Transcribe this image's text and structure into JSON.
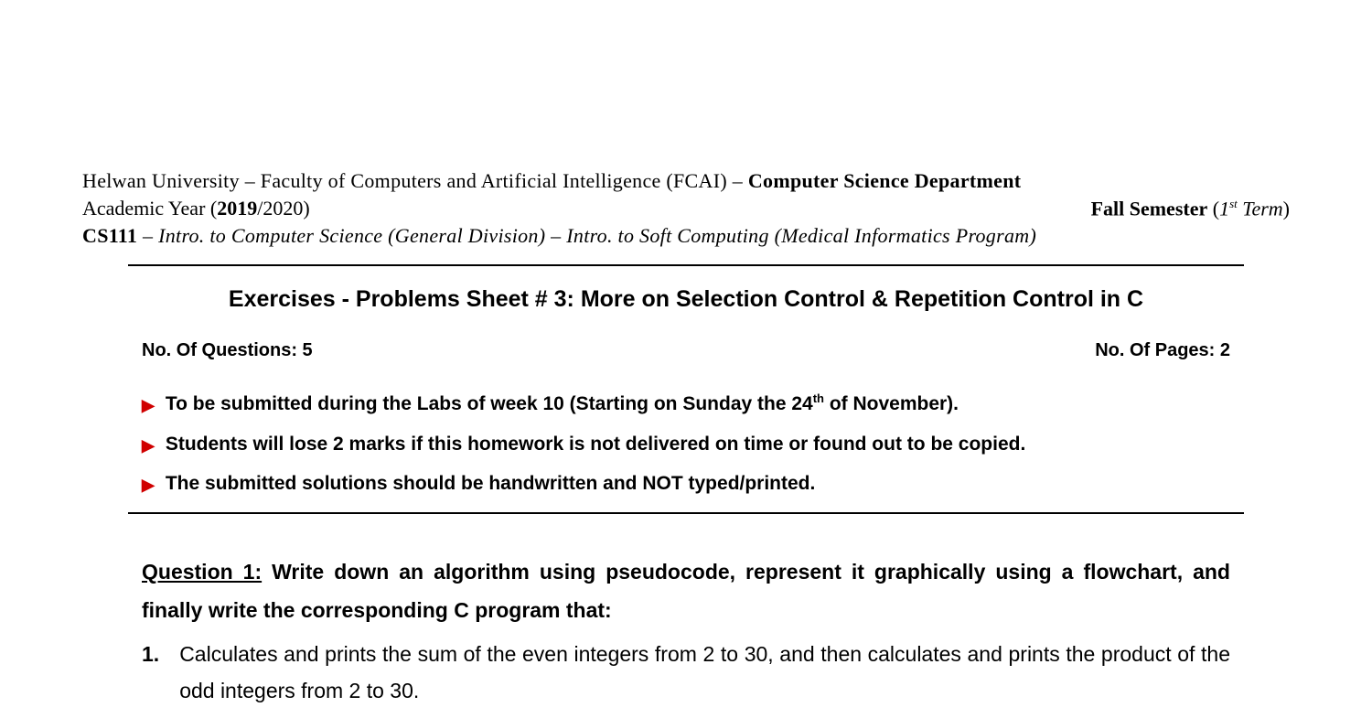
{
  "header": {
    "line1_prefix": "Helwan University – Faculty of Computers and Artificial Intelligence (FCAI) – ",
    "line1_bold": "Computer Science Department",
    "year_prefix": "Academic Year (",
    "year_bold": "2019",
    "year_suffix": "/2020)",
    "semester_bold": "Fall Semester",
    "semester_paren_open": " (",
    "semester_num": "1",
    "semester_sup": "st",
    "semester_italic": " Term",
    "semester_paren_close": ")",
    "course_bold": "CS111",
    "course_rest": " – Intro. to Computer Science (General Division) – Intro. to Soft Computing (Medical Informatics Program)"
  },
  "sheet": {
    "title": "Exercises - Problems Sheet # 3: More on Selection Control & Repetition Control in C",
    "num_questions": "No. Of Questions: 5",
    "num_pages": "No. Of Pages: 2"
  },
  "instructions": {
    "item1_a": "To be submitted during the Labs of week 10 (Starting on Sunday the 24",
    "item1_sup": "th",
    "item1_b": " of November).",
    "item2": "Students will lose 2 marks if this homework is not delivered on time or found out to be copied.",
    "item3": "The submitted solutions should be handwritten and NOT typed/printed."
  },
  "question1": {
    "label": "Question 1:",
    "prompt": " Write down an algorithm using pseudocode, represent it graphically using a flowchart, and finally write the corresponding C program that:",
    "sub1_num": "1.",
    "sub1_text": "Calculates and prints the sum of the even integers from 2 to 30, and then calculates and prints the product of the odd integers from 2 to 30."
  }
}
